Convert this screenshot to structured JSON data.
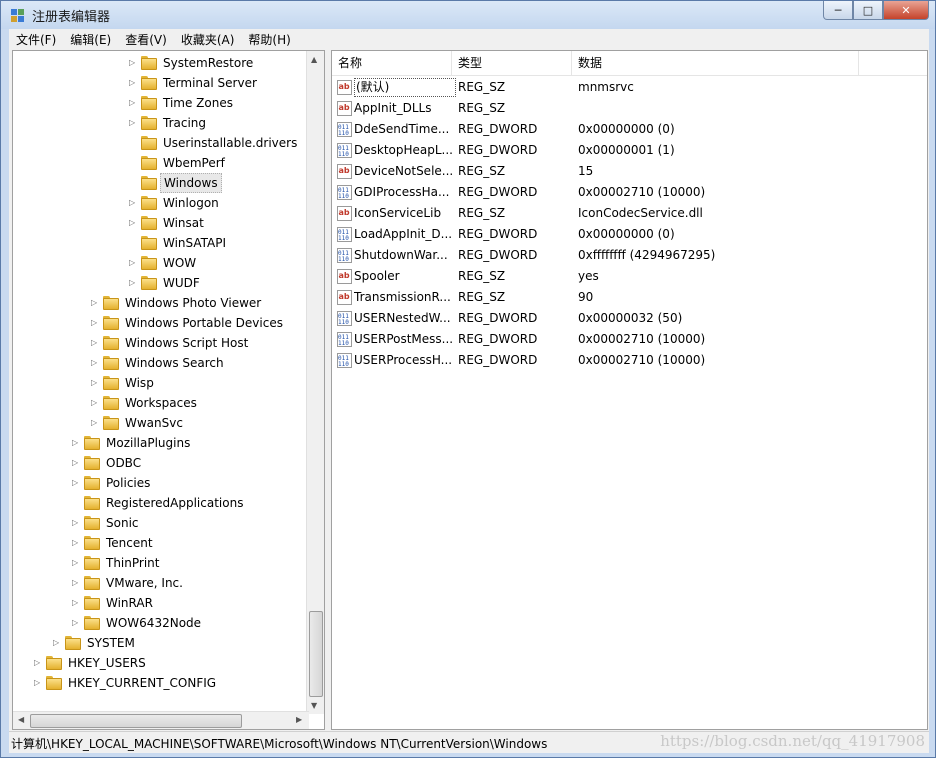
{
  "window": {
    "title": "注册表编辑器",
    "minimize": "─",
    "maximize": "□",
    "close": "✕"
  },
  "menu": [
    "文件(F)",
    "编辑(E)",
    "查看(V)",
    "收藏夹(A)",
    "帮助(H)"
  ],
  "tree": {
    "selected": "Windows",
    "items": [
      {
        "label": "SystemRestore",
        "expandable": true
      },
      {
        "label": "Terminal Server",
        "expandable": true
      },
      {
        "label": "Time Zones",
        "expandable": true
      },
      {
        "label": "Tracing",
        "expandable": true
      },
      {
        "label": "Userinstallable.drivers",
        "expandable": false
      },
      {
        "label": "WbemPerf",
        "expandable": false
      },
      {
        "label": "Windows",
        "expandable": false
      },
      {
        "label": "Winlogon",
        "expandable": true
      },
      {
        "label": "Winsat",
        "expandable": true
      },
      {
        "label": "WinSATAPI",
        "expandable": false
      },
      {
        "label": "WOW",
        "expandable": true
      },
      {
        "label": "WUDF",
        "expandable": true
      },
      {
        "label": "Windows Photo Viewer",
        "expandable": true
      },
      {
        "label": "Windows Portable Devices",
        "expandable": true
      },
      {
        "label": "Windows Script Host",
        "expandable": true
      },
      {
        "label": "Windows Search",
        "expandable": true
      },
      {
        "label": "Wisp",
        "expandable": true
      },
      {
        "label": "Workspaces",
        "expandable": true
      },
      {
        "label": "WwanSvc",
        "expandable": true
      },
      {
        "label": "MozillaPlugins",
        "expandable": true
      },
      {
        "label": "ODBC",
        "expandable": true
      },
      {
        "label": "Policies",
        "expandable": true
      },
      {
        "label": "RegisteredApplications",
        "expandable": false
      },
      {
        "label": "Sonic",
        "expandable": true
      },
      {
        "label": "Tencent",
        "expandable": true
      },
      {
        "label": "ThinPrint",
        "expandable": true
      },
      {
        "label": "VMware, Inc.",
        "expandable": true
      },
      {
        "label": "WinRAR",
        "expandable": true
      },
      {
        "label": "WOW6432Node",
        "expandable": true
      },
      {
        "label": "SYSTEM",
        "expandable": true
      },
      {
        "label": "HKEY_USERS",
        "expandable": true
      },
      {
        "label": "HKEY_CURRENT_CONFIG",
        "expandable": true
      }
    ]
  },
  "list": {
    "headers": {
      "name": "名称",
      "type": "类型",
      "data": "数据"
    },
    "rows": [
      {
        "name": "(默认)",
        "type": "REG_SZ",
        "data": "mnmsrvc",
        "icon": "string-value-icon"
      },
      {
        "name": "AppInit_DLLs",
        "type": "REG_SZ",
        "data": "",
        "icon": "string-value-icon"
      },
      {
        "name": "DdeSendTime...",
        "type": "REG_DWORD",
        "data": "0x00000000 (0)",
        "icon": "binary-value-icon"
      },
      {
        "name": "DesktopHeapL...",
        "type": "REG_DWORD",
        "data": "0x00000001 (1)",
        "icon": "binary-value-icon"
      },
      {
        "name": "DeviceNotSele...",
        "type": "REG_SZ",
        "data": "15",
        "icon": "string-value-icon"
      },
      {
        "name": "GDIProcessHa...",
        "type": "REG_DWORD",
        "data": "0x00002710 (10000)",
        "icon": "binary-value-icon"
      },
      {
        "name": "IconServiceLib",
        "type": "REG_SZ",
        "data": "IconCodecService.dll",
        "icon": "string-value-icon"
      },
      {
        "name": "LoadAppInit_D...",
        "type": "REG_DWORD",
        "data": "0x00000000 (0)",
        "icon": "binary-value-icon"
      },
      {
        "name": "ShutdownWar...",
        "type": "REG_DWORD",
        "data": "0xffffffff (4294967295)",
        "icon": "binary-value-icon"
      },
      {
        "name": "Spooler",
        "type": "REG_SZ",
        "data": "yes",
        "icon": "string-value-icon"
      },
      {
        "name": "TransmissionR...",
        "type": "REG_SZ",
        "data": "90",
        "icon": "string-value-icon"
      },
      {
        "name": "USERNestedW...",
        "type": "REG_DWORD",
        "data": "0x00000032 (50)",
        "icon": "binary-value-icon"
      },
      {
        "name": "USERPostMess...",
        "type": "REG_DWORD",
        "data": "0x00002710 (10000)",
        "icon": "binary-value-icon"
      },
      {
        "name": "USERProcessH...",
        "type": "REG_DWORD",
        "data": "0x00002710 (10000)",
        "icon": "binary-value-icon"
      }
    ]
  },
  "status": {
    "path": "计算机\\HKEY_LOCAL_MACHINE\\SOFTWARE\\Microsoft\\Windows NT\\CurrentVersion\\Windows"
  },
  "watermark": "https://blog.csdn.net/qq_41917908",
  "colors": {
    "selection": "#e8e8e8",
    "folder": "#f3c64a",
    "string_icon": "#c0392b",
    "binary_icon": "#1f4fa8"
  }
}
